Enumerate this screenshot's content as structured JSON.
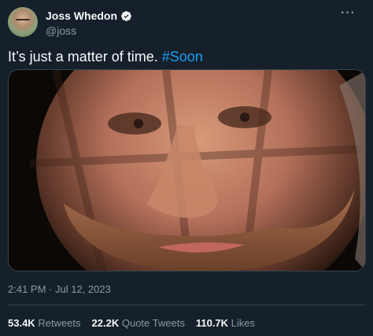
{
  "author": {
    "display_name": "Joss Whedon",
    "handle": "@joss",
    "verified": true,
    "avatar_icon": "avatar-photo"
  },
  "menu_icon": "more-options-icon",
  "tweet": {
    "text_prefix": "It’s just a matter of time. ",
    "hashtag": "#Soon",
    "media_description_icon": "photo-closeup-face"
  },
  "meta": {
    "time": "2:41 PM",
    "separator": " · ",
    "date": "Jul 12, 2023"
  },
  "stats": [
    {
      "count": "53.4K",
      "label": "Retweets"
    },
    {
      "count": "22.2K",
      "label": "Quote Tweets"
    },
    {
      "count": "110.7K",
      "label": "Likes"
    }
  ],
  "colors": {
    "background": "#15202b",
    "text": "#f7f9f9",
    "secondary": "#8b98a5",
    "accent": "#1d9bf0",
    "divider": "#38444d"
  }
}
